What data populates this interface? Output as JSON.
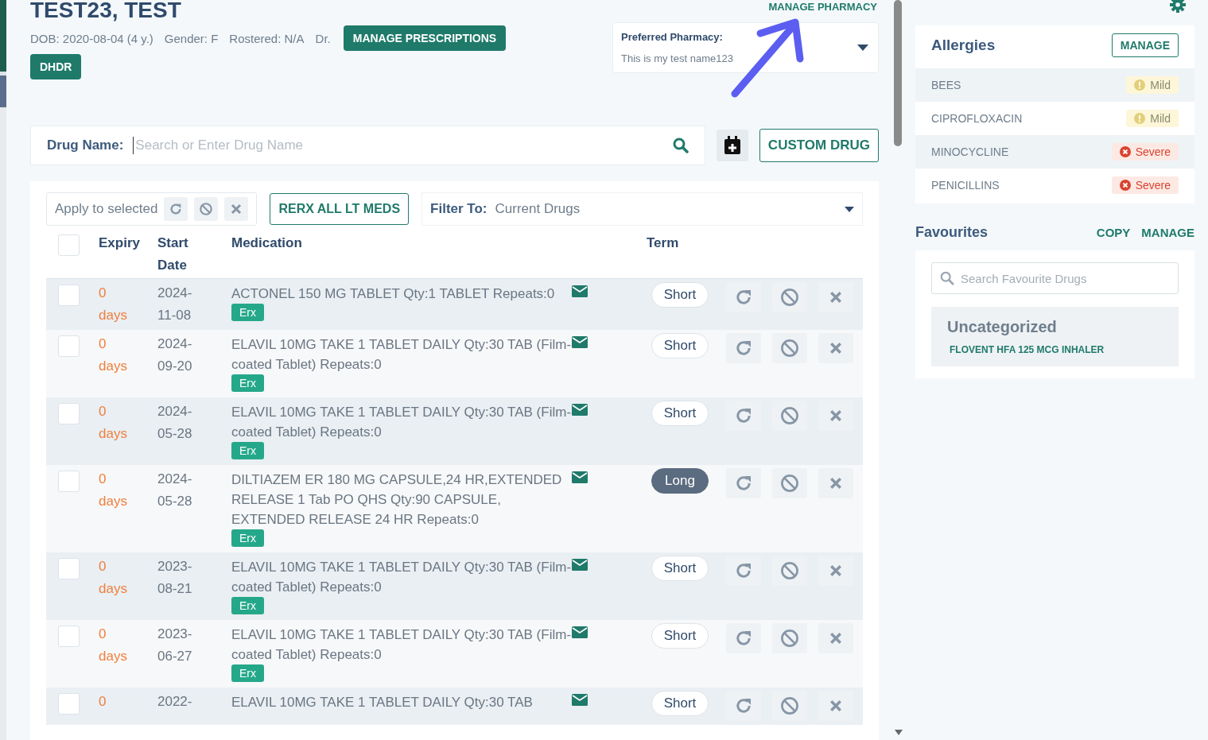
{
  "patient": {
    "name": "TEST23, TEST",
    "dob": "DOB: 2020-08-04 (4 y.)",
    "gender": "Gender: F",
    "rostered": "Rostered: N/A",
    "doctor": "Dr."
  },
  "header_buttons": [
    "MANAGE PRESCRIPTIONS",
    "DHDR"
  ],
  "pharmacy": {
    "link": "MANAGE PHARMACY",
    "label": "Preferred Pharmacy:",
    "value": "This is my test name123"
  },
  "drug_search": {
    "label": "Drug Name:",
    "placeholder": "Search or Enter Drug Name",
    "custom_button": "CUSTOM DRUG"
  },
  "toolbar": {
    "apply_label": "Apply to selected",
    "rerx_button": "RERX ALL LT MEDS",
    "filter_label": "Filter To:",
    "filter_value": "Current Drugs"
  },
  "table": {
    "select_all_checked": false,
    "columns": [
      "Expiry",
      "Start Date",
      "Medication",
      "Term"
    ],
    "rows": [
      {
        "checked": false,
        "expiry": "0 days",
        "start_date": "2024-11-08",
        "medication": "ACTONEL 150 MG TABLET Qty:1 TABLET Repeats:0",
        "tag": "Erx",
        "term": "Short",
        "long_term": false
      },
      {
        "checked": false,
        "expiry": "0 days",
        "start_date": "2024-09-20",
        "medication": "ELAVIL 10MG TAKE 1 TABLET DAILY Qty:30 TAB (Film-coated Tablet) Repeats:0",
        "tag": "Erx",
        "term": "Short",
        "long_term": false
      },
      {
        "checked": false,
        "expiry": "0 days",
        "start_date": "2024-05-28",
        "medication": "ELAVIL 10MG TAKE 1 TABLET DAILY Qty:30 TAB (Film-coated Tablet) Repeats:0",
        "tag": "Erx",
        "term": "Short",
        "long_term": false
      },
      {
        "checked": false,
        "expiry": "0 days",
        "start_date": "2024-05-28",
        "medication": "DILTIAZEM ER 180 MG CAPSULE,24 HR,EXTENDED RELEASE 1 Tab PO QHS Qty:90 CAPSULE, EXTENDED RELEASE 24 HR Repeats:0",
        "tag": "Erx",
        "term": "Long",
        "long_term": true
      },
      {
        "checked": false,
        "expiry": "0 days",
        "start_date": "2023-08-21",
        "medication": "ELAVIL 10MG TAKE 1 TABLET DAILY Qty:30 TAB (Film-coated Tablet) Repeats:0",
        "tag": "Erx",
        "term": "Short",
        "long_term": false
      },
      {
        "checked": false,
        "expiry": "0 days",
        "start_date": "2023-06-27",
        "medication": "ELAVIL 10MG TAKE 1 TABLET DAILY Qty:30 TAB (Film-coated Tablet) Repeats:0",
        "tag": "Erx",
        "term": "Short",
        "long_term": false
      },
      {
        "checked": false,
        "expiry": "0",
        "start_date": "2022-",
        "medication": "ELAVIL 10MG TAKE 1 TABLET DAILY Qty:30 TAB",
        "term": "Short",
        "long_term": false
      }
    ]
  },
  "allergies": {
    "title": "Allergies",
    "manage_button": "MANAGE",
    "items": [
      {
        "name": "BEES",
        "severity": "Mild",
        "kind": "mild"
      },
      {
        "name": "CIPROFLOXACIN",
        "severity": "Mild",
        "kind": "mild"
      },
      {
        "name": "MINOCYCLINE",
        "severity": "Severe",
        "kind": "severe"
      },
      {
        "name": "PENICILLINS",
        "severity": "Severe",
        "kind": "severe"
      }
    ]
  },
  "favourites": {
    "title": "Favourites",
    "actions": [
      "COPY",
      "MANAGE"
    ],
    "placeholder": "Search Favourite Drugs",
    "groups": [
      {
        "title": "Uncategorized",
        "items": [
          "FLOVENT HFA 125 MCG INHALER"
        ]
      }
    ]
  }
}
